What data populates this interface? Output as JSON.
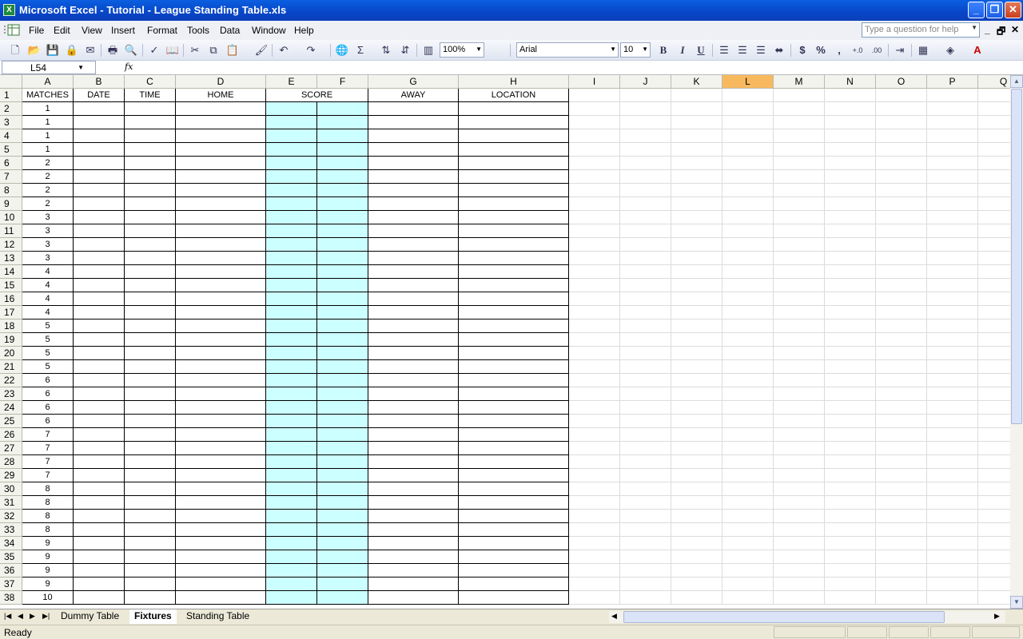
{
  "window": {
    "title": "Microsoft Excel - Tutorial - League Standing Table.xls"
  },
  "menu": [
    "File",
    "Edit",
    "View",
    "Insert",
    "Format",
    "Tools",
    "Data",
    "Window",
    "Help"
  ],
  "help_placeholder": "Type a question for help",
  "toolbar": {
    "zoom": "100%",
    "font": "Arial",
    "size": "10",
    "bold": "B",
    "italic": "I",
    "underline": "U",
    "currency": "$",
    "percent": "%",
    "comma": ","
  },
  "formula": {
    "name_box": "L54",
    "fx": "fx",
    "value": ""
  },
  "columns": [
    "A",
    "B",
    "C",
    "D",
    "E",
    "F",
    "G",
    "H",
    "I",
    "J",
    "K",
    "L",
    "M",
    "N",
    "O",
    "P",
    "Q"
  ],
  "selected_column": "L",
  "rows": [
    "1",
    "2",
    "3",
    "4",
    "5",
    "6",
    "7",
    "8",
    "9",
    "10",
    "11",
    "12",
    "13",
    "14",
    "15",
    "16",
    "17",
    "18",
    "19",
    "20",
    "21",
    "22",
    "23",
    "24",
    "25",
    "26",
    "27",
    "28",
    "29",
    "30",
    "31",
    "32",
    "33",
    "34",
    "35",
    "36",
    "37",
    "38"
  ],
  "headers": {
    "matches": "MATCHES",
    "date": "DATE",
    "time": "TIME",
    "home": "HOME",
    "score": "SCORE",
    "away": "AWAY",
    "location": "LOCATION"
  },
  "matches": [
    "1",
    "1",
    "1",
    "1",
    "2",
    "2",
    "2",
    "2",
    "3",
    "3",
    "3",
    "3",
    "4",
    "4",
    "4",
    "4",
    "5",
    "5",
    "5",
    "5",
    "6",
    "6",
    "6",
    "6",
    "7",
    "7",
    "7",
    "7",
    "8",
    "8",
    "8",
    "8",
    "9",
    "9",
    "9",
    "9",
    "10"
  ],
  "score_fill": "#ccffff",
  "sheets": [
    "Dummy Table",
    "Fixtures",
    "Standing Table"
  ],
  "active_sheet": "Fixtures",
  "status": "Ready"
}
